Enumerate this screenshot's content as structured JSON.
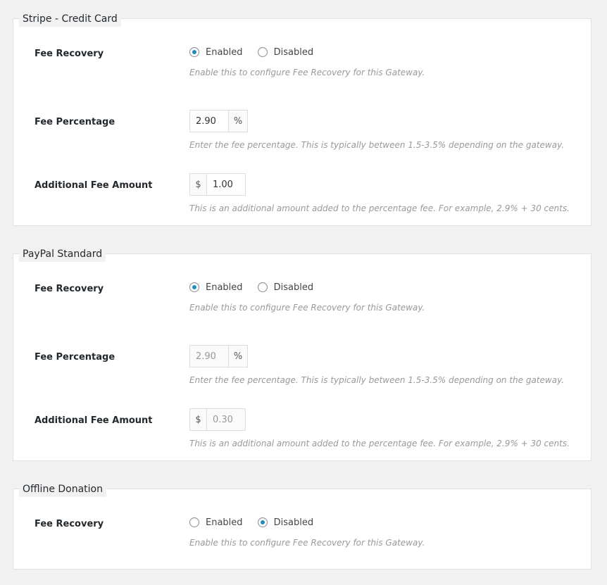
{
  "gateways": [
    {
      "title": "Stripe - Credit Card",
      "fee_recovery": {
        "label": "Fee Recovery",
        "enabled_label": "Enabled",
        "disabled_label": "Disabled",
        "selected": "Enabled",
        "description": "Enable this to configure Fee Recovery for this Gateway."
      },
      "fee_percentage": {
        "label": "Fee Percentage",
        "value": "2.90",
        "suffix": "%",
        "description": "Enter the fee percentage. This is typically between 1.5-3.5% depending on the gateway."
      },
      "additional_fee": {
        "label": "Additional Fee Amount",
        "prefix": "$",
        "value": "1.00",
        "description": "This is an additional amount added to the percentage fee. For example, 2.9% + 30 cents."
      }
    },
    {
      "title": "PayPal Standard",
      "fee_recovery": {
        "label": "Fee Recovery",
        "enabled_label": "Enabled",
        "disabled_label": "Disabled",
        "selected": "Enabled",
        "description": "Enable this to configure Fee Recovery for this Gateway."
      },
      "fee_percentage": {
        "label": "Fee Percentage",
        "value": "2.90",
        "suffix": "%",
        "description": "Enter the fee percentage. This is typically between 1.5-3.5% depending on the gateway."
      },
      "additional_fee": {
        "label": "Additional Fee Amount",
        "prefix": "$",
        "value": "0.30",
        "description": "This is an additional amount added to the percentage fee. For example, 2.9% + 30 cents."
      }
    },
    {
      "title": "Offline Donation",
      "fee_recovery": {
        "label": "Fee Recovery",
        "enabled_label": "Enabled",
        "disabled_label": "Disabled",
        "selected": "Disabled",
        "description": "Enable this to configure Fee Recovery for this Gateway."
      }
    }
  ],
  "colors": {
    "radio_checked": "#1e8cbe",
    "description_text": "#999999",
    "page_background": "#f1f1f1"
  }
}
